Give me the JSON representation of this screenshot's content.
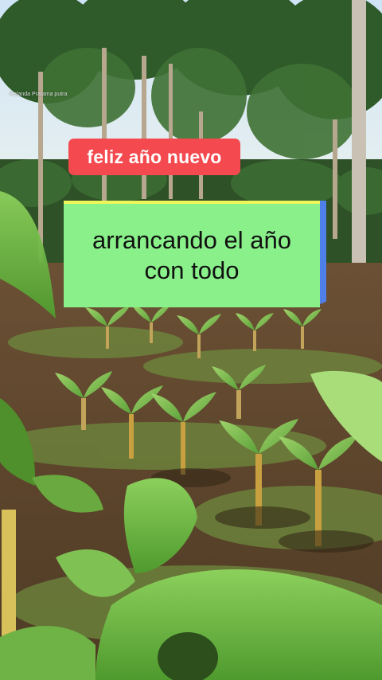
{
  "watermark": "Relanda Pratama putra",
  "captions": {
    "greeting": "feliz año nuevo",
    "line1": "arrancando el año",
    "line2": "con todo"
  },
  "colors": {
    "greeting_bg": "#f44a4f",
    "main_bg": "#89f08a",
    "main_side": "#4f7fe8",
    "main_top": "#eef65a"
  }
}
